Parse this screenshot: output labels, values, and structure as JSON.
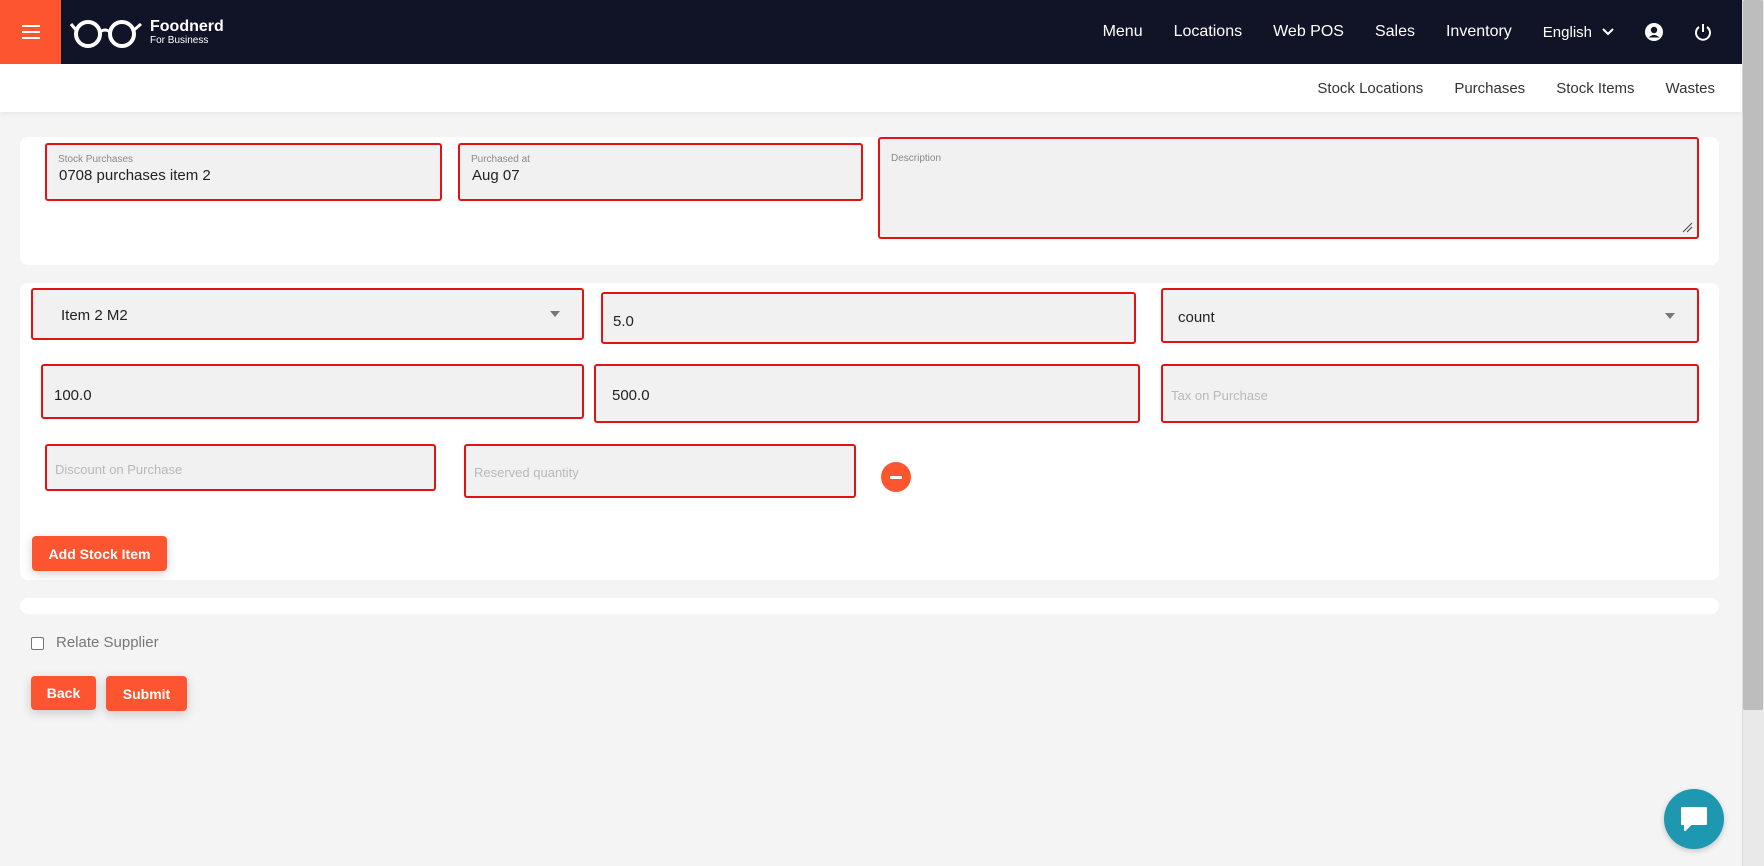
{
  "app": {
    "name": "Foodnerd",
    "tagline": "For Business"
  },
  "nav": {
    "items": [
      "Menu",
      "Locations",
      "Web POS",
      "Sales",
      "Inventory"
    ],
    "language": "English"
  },
  "subnav": {
    "links": [
      "Stock Locations",
      "Purchases",
      "Stock Items",
      "Wastes"
    ]
  },
  "purchase": {
    "stock_purchases_label": "Stock Purchases",
    "stock_purchases_value": "0708 purchases item 2",
    "purchased_at_label": "Purchased at",
    "purchased_at_value": "Aug 07",
    "description_label": "Description",
    "description_value": ""
  },
  "stock_item": {
    "item_selected": "Item 2 M2",
    "quantity": "5.0",
    "unit_selected": "count",
    "unit_price": "100.0",
    "total_price": "500.0",
    "tax_placeholder": "Tax on Purchase",
    "discount_placeholder": "Discount on Purchase",
    "reserved_placeholder": "Reserved quantity"
  },
  "buttons": {
    "add_stock_item": "Add Stock Item",
    "back": "Back",
    "submit": "Submit"
  },
  "supplier": {
    "label": "Relate Supplier",
    "checked": false
  },
  "colors": {
    "accent": "#fd5530",
    "topbar": "#101426",
    "highlight": "#e01414",
    "chat": "#1e97b1"
  },
  "icons": [
    "hamburger-menu-icon",
    "glasses-logo-icon",
    "chevron-down-icon",
    "user-account-icon",
    "power-icon",
    "minus-circle-icon",
    "chat-bubble-icon"
  ]
}
